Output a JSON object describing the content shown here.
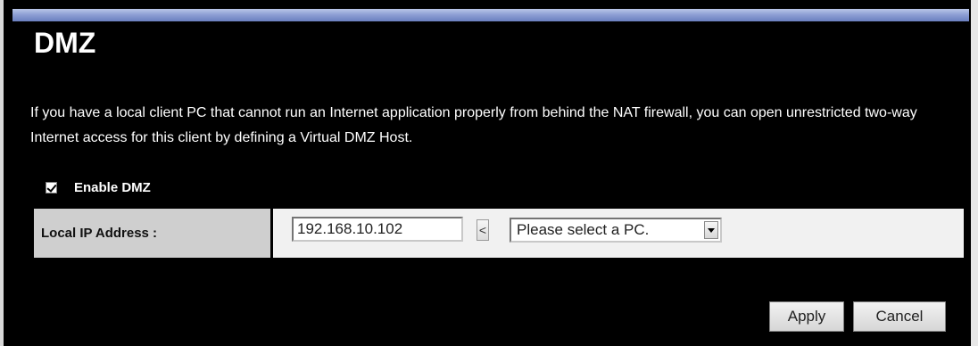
{
  "page": {
    "title": "DMZ",
    "description": "If you have a local client PC that cannot run an Internet application properly from behind the NAT firewall, you can open unrestricted two-way Internet access for this client by defining a Virtual DMZ Host."
  },
  "enable_dmz": {
    "label": "Enable DMZ",
    "checked": true
  },
  "local_ip": {
    "label": "Local IP Address :",
    "value": "192.168.10.102",
    "copy_button": "<",
    "pc_select": "Please select a PC."
  },
  "buttons": {
    "apply": "Apply",
    "cancel": "Cancel"
  },
  "colors": {
    "background": "#000000",
    "header_bar": "#8ea0d4",
    "label_cell": "#cfcfcf",
    "value_cell": "#f1f1f1"
  }
}
